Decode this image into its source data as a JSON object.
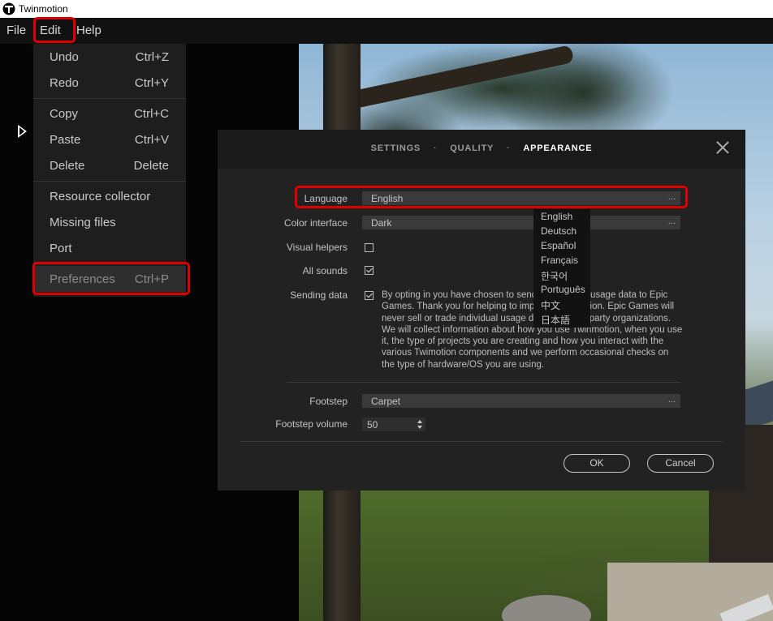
{
  "window": {
    "title": "Twinmotion"
  },
  "menubar": {
    "file": "File",
    "edit": "Edit",
    "help": "Help"
  },
  "edit_menu": {
    "items": [
      {
        "label": "Undo",
        "shortcut": "Ctrl+Z"
      },
      {
        "label": "Redo",
        "shortcut": "Ctrl+Y"
      },
      {
        "label": "Copy",
        "shortcut": "Ctrl+C"
      },
      {
        "label": "Paste",
        "shortcut": "Ctrl+V"
      },
      {
        "label": "Delete",
        "shortcut": "Delete"
      },
      {
        "label": "Resource collector",
        "shortcut": ""
      },
      {
        "label": "Missing files",
        "shortcut": ""
      },
      {
        "label": "Port",
        "shortcut": ""
      },
      {
        "label": "Preferences",
        "shortcut": "Ctrl+P"
      }
    ]
  },
  "dialog": {
    "tabs": [
      "SETTINGS",
      "QUALITY",
      "APPEARANCE"
    ],
    "active_tab": "APPEARANCE",
    "separator": "·",
    "language": {
      "label": "Language",
      "value": "English"
    },
    "color_interface": {
      "label": "Color interface",
      "value": "Dark"
    },
    "visual_helpers": {
      "label": "Visual helpers",
      "checked": false
    },
    "all_sounds": {
      "label": "All sounds",
      "checked": true
    },
    "sending_data": {
      "label": "Sending data",
      "checked": true,
      "text": "By opting in you have chosen to send anonymous usage data to Epic Games. Thank you for helping to improve Twinmotion. Epic Games will never sell or trade individual usage data with third party organizations. We will collect information about how you use Twinmotion, when you use it, the type of projects you are creating and how you interact with the various Twimotion components and we perform occasional checks on the type of hardware/OS you are using."
    },
    "footstep": {
      "label": "Footstep",
      "value": "Carpet"
    },
    "footstep_volume": {
      "label": "Footstep volume",
      "value": "50"
    },
    "ok": "OK",
    "cancel": "Cancel",
    "dots": "..."
  },
  "language_options": [
    "English",
    "Deutsch",
    "Español",
    "Français",
    "한국어",
    "Português",
    "中文",
    "日本語"
  ],
  "colors": {
    "highlight": "#e00000",
    "dialog_bg": "#222222",
    "menu_bg": "#1e1e1e"
  }
}
